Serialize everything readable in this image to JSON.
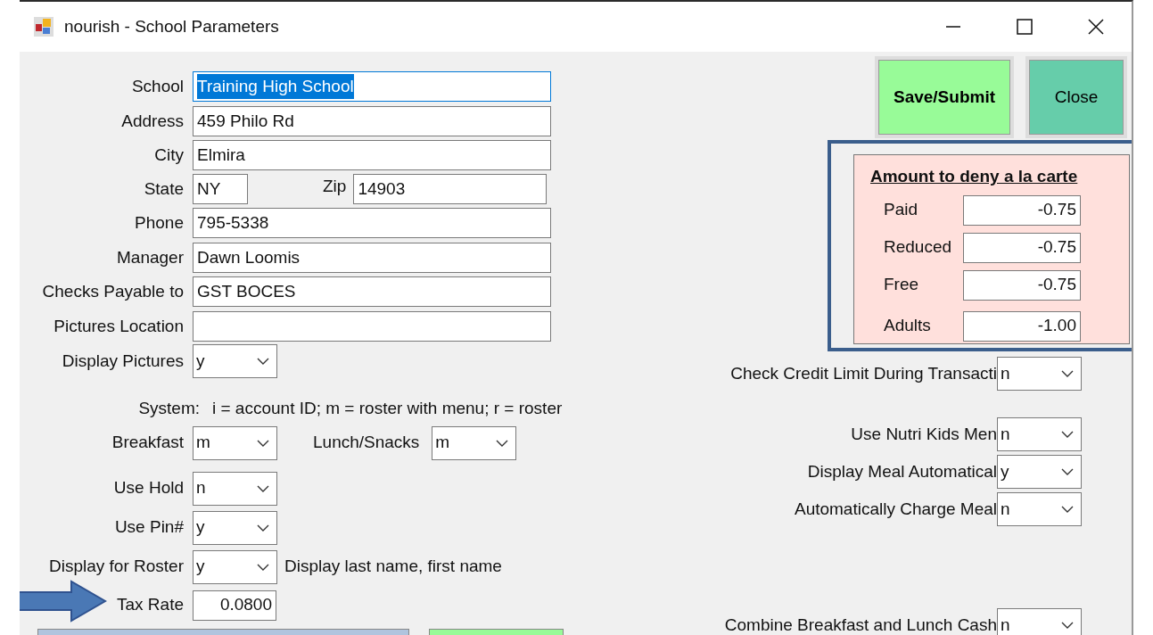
{
  "window": {
    "title": "nourish - School Parameters"
  },
  "left_rows": [
    {
      "kind": "text",
      "label": "School",
      "value": "Training High School",
      "focused": true
    },
    {
      "kind": "text",
      "label": "Address",
      "value": "459 Philo Rd",
      "focused": false
    },
    {
      "kind": "text",
      "label": "City",
      "value": "Elmira",
      "focused": false
    },
    {
      "kind": "pair",
      "label": "State",
      "value": "NY",
      "label2": "Zip",
      "value2": "14903"
    },
    {
      "kind": "text",
      "label": "Phone",
      "value": "795-5338",
      "focused": false
    },
    {
      "kind": "text",
      "label": "Manager",
      "value": "Dawn Loomis",
      "focused": false
    },
    {
      "kind": "text",
      "label": "Checks Payable to",
      "value": "GST BOCES",
      "focused": false
    },
    {
      "kind": "text",
      "label": "Pictures Location",
      "focused": false
    },
    {
      "kind": "select",
      "label": "Display Pictures",
      "value": "y"
    },
    {
      "kind": "note",
      "label": "System:",
      "text": "i = account ID;  m = roster with menu;  r = roster"
    },
    {
      "kind": "dual",
      "label": "Breakfast",
      "value": "m",
      "label2": "Lunch/Snacks",
      "value2": "m"
    },
    {
      "kind": "select",
      "label": "Use Hold",
      "value": "n"
    },
    {
      "kind": "select",
      "label": "Use Pin#",
      "value": "y"
    },
    {
      "kind": "select",
      "label": "Display for Roster",
      "value": "y",
      "note": "Display last name, first name"
    },
    {
      "kind": "number",
      "label": "Tax Rate",
      "value": "0.0800"
    }
  ],
  "buttons": [
    {
      "kind": "save",
      "label": "Save/Submit"
    },
    {
      "kind": "close",
      "label": "Close"
    }
  ],
  "deny_panel": {
    "title": "Amount to deny a la carte",
    "rows": [
      {
        "label": "Paid",
        "value": "-0.75"
      },
      {
        "label": "Reduced",
        "value": "-0.75"
      },
      {
        "label": "Free",
        "value": "-0.75"
      },
      {
        "label": "Adults",
        "value": "-1.00"
      }
    ]
  },
  "right_selects": [
    {
      "label": "Check Credit Limit During Transacti",
      "value": "n"
    },
    {
      "label": "Use Nutri Kids Men",
      "value": "n"
    },
    {
      "label": "Display Meal Automatical",
      "value": "y"
    },
    {
      "label": "Automatically Charge Meal",
      "value": "n"
    },
    {
      "label": "Combine Breakfast and Lunch Cash",
      "value": "n"
    }
  ],
  "bottom_buttons": [
    {
      "kind": "blue"
    },
    {
      "kind": "green"
    }
  ]
}
